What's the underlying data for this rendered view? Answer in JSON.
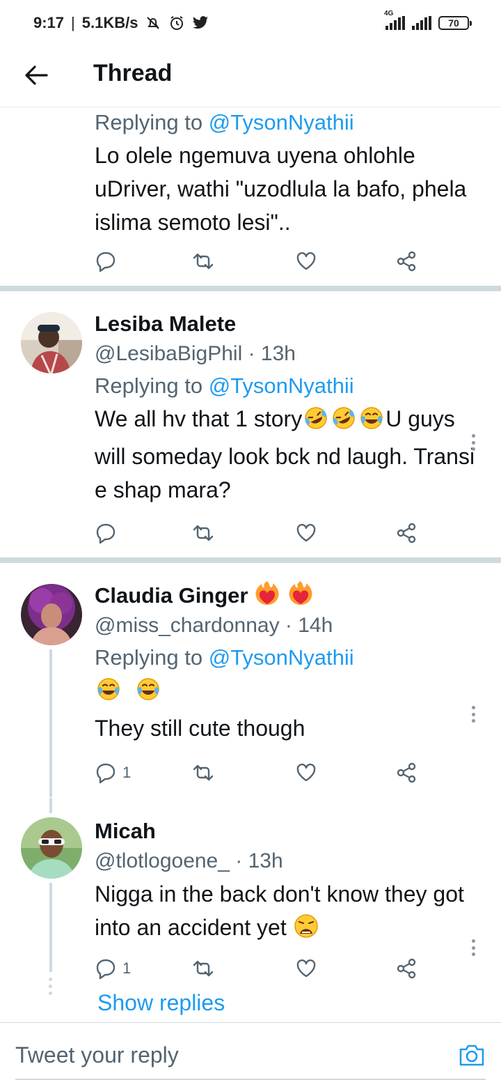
{
  "status_bar": {
    "time": "9:17",
    "speed": "5.1KB/s",
    "network": "4G",
    "battery": "70"
  },
  "header": {
    "title": "Thread"
  },
  "tweets": [
    {
      "replying_prefix": "Replying to ",
      "replying_to": "@TysonNyathii",
      "text": "Lo olele ngemuva uyena ohlohle uDriver, wathi \"uzodlula la bafo, phela islima semoto lesi\"..",
      "reply_count": ""
    },
    {
      "name": "Lesiba Malete",
      "handle": "@LesibaBigPhil",
      "time": "· 13h",
      "replying_prefix": "Replying to ",
      "replying_to": "@TysonNyathii",
      "text_a": "We all hv that 1 story",
      "text_b": "U guys will someday look bck nd laugh. Transi e shap mara?",
      "reply_count": ""
    },
    {
      "name": "Claudia Ginger",
      "handle": "@miss_chardonnay",
      "time": "· 14h",
      "replying_prefix": "Replying to ",
      "replying_to": "@TysonNyathii",
      "text": "They still cute though",
      "reply_count": "1"
    },
    {
      "name": "Micah",
      "handle": "@tlotlogoene_",
      "time": "· 13h",
      "text": "Nigga in the back don't know they got into an accident yet",
      "reply_count": "1"
    }
  ],
  "show_replies": "Show replies",
  "composer": {
    "placeholder": "Tweet your reply"
  },
  "colors": {
    "accent": "#1d9bf0",
    "secondary_text": "#536471",
    "divider": "#cfd9de"
  },
  "icons": [
    "back-arrow-icon",
    "reply-icon",
    "retweet-icon",
    "like-icon",
    "share-icon",
    "more-icon",
    "camera-icon"
  ]
}
